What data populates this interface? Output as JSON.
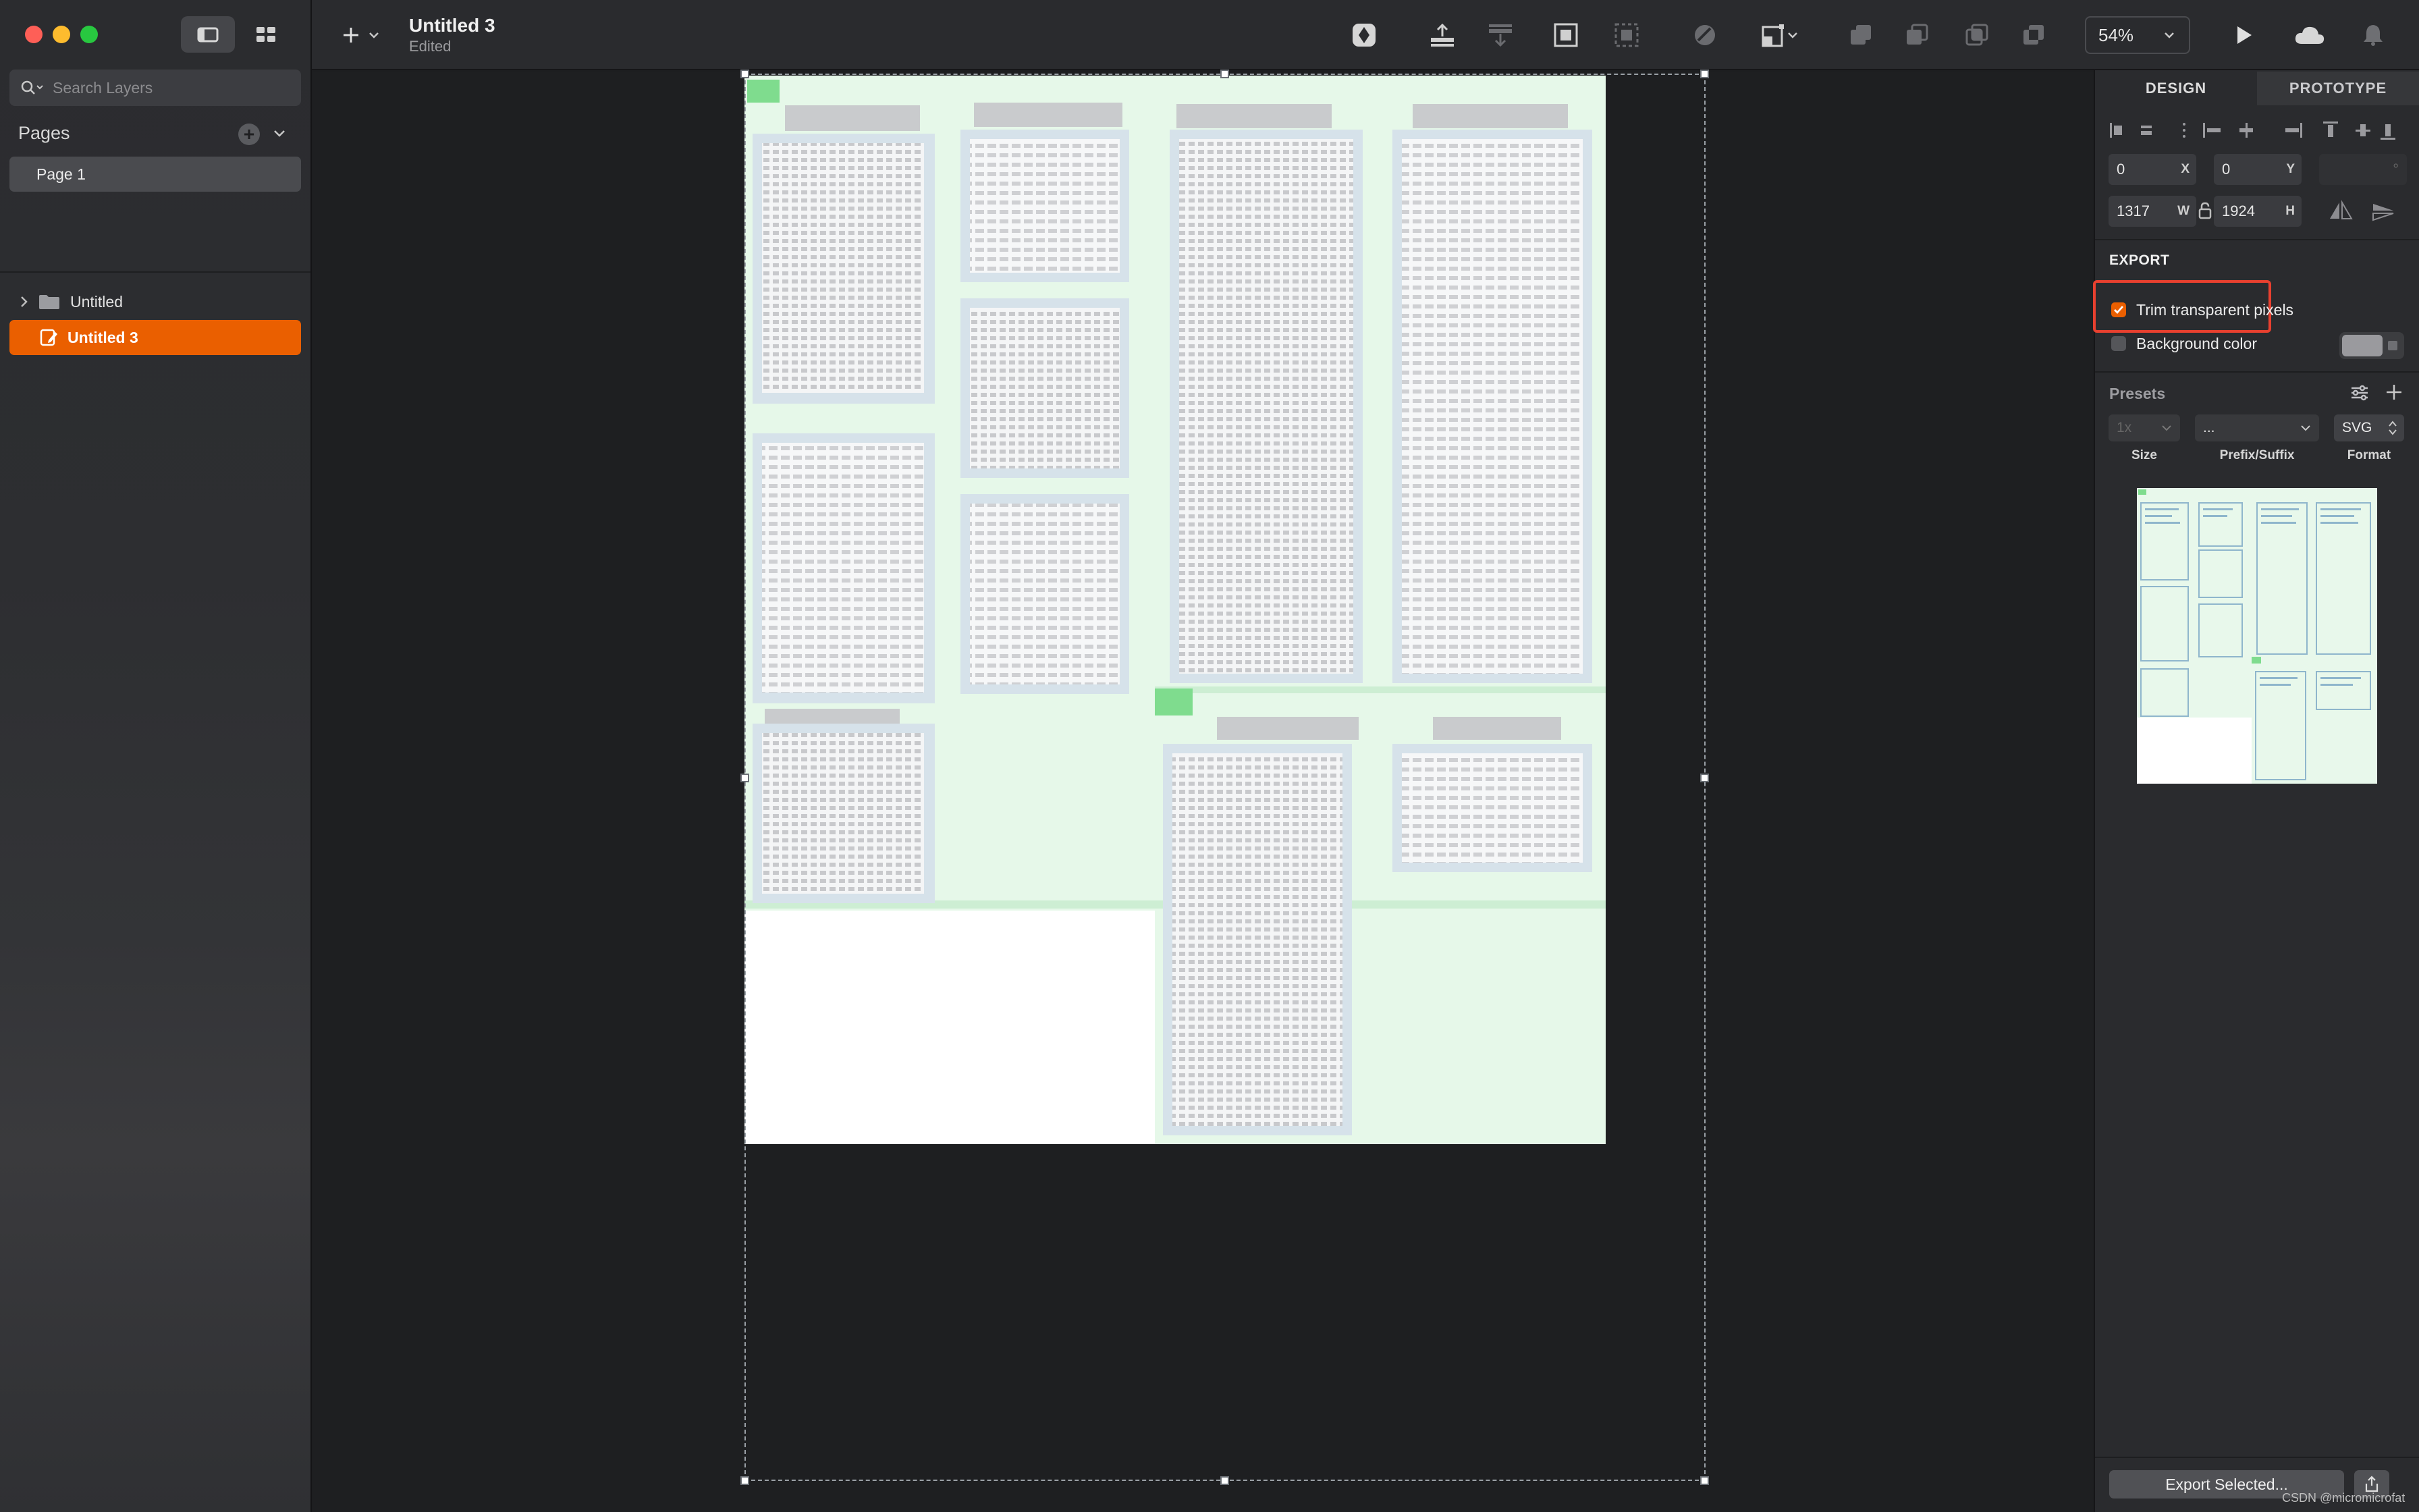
{
  "sidebar": {
    "search_placeholder": "Search Layers",
    "pages_label": "Pages",
    "pages_add_symbol": "+",
    "page_item": "Page 1",
    "layers": [
      "Untitled",
      "Untitled 3"
    ]
  },
  "toolbar": {
    "doc_title": "Untitled 3",
    "doc_status": "Edited",
    "zoom": "54%"
  },
  "right_panel": {
    "tabs": [
      "DESIGN",
      "PROTOTYPE"
    ],
    "x_value": "0",
    "x_label": "X",
    "y_value": "0",
    "y_label": "Y",
    "rotation_suffix": "°",
    "w_value": "1317",
    "w_label": "W",
    "h_value": "1924",
    "h_label": "H",
    "export_title": "EXPORT",
    "trim_label": "Trim transparent pixels",
    "trim_checked": true,
    "bg_color_label": "Background color",
    "bg_color_checked": false,
    "presets_label": "Presets",
    "size_value": "1x",
    "prefix_value": "...",
    "format_value": "SVG",
    "size_label": "Size",
    "prefix_label": "Prefix/Suffix",
    "format_label": "Format",
    "export_button": "Export Selected...",
    "watermark": "CSDN @micromicrofat"
  },
  "colors": {
    "accent_orange": "#ea5f00",
    "highlight_red": "#e8402f",
    "artboard_green": "#e6f8e9"
  },
  "icons": [
    "search-icon",
    "canvas-view-icon",
    "grid-view-icon",
    "plus-icon",
    "chevron-down-icon",
    "folder-icon",
    "artboard-icon",
    "play-icon",
    "cloud-icon",
    "bell-icon",
    "share-icon"
  ]
}
